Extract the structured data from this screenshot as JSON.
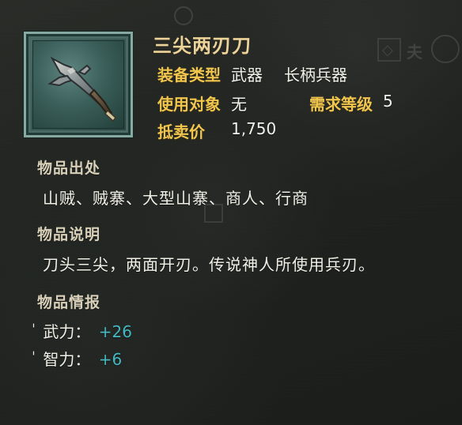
{
  "item": {
    "name": "三尖两刃刀"
  },
  "attributes": {
    "equipment_type_label": "装备类型",
    "equipment_type_value": "武器",
    "equipment_subtype_value": "长柄兵器",
    "use_target_label": "使用对象",
    "use_target_value": "无",
    "required_level_label": "需求等级",
    "required_level_value": "5",
    "sell_price_label": "抵卖价",
    "sell_price_value": "1,750"
  },
  "sections": {
    "source_title": "物品出处",
    "source_text": "山贼、贼寨、大型山寨、商人、行商",
    "description_title": "物品说明",
    "description_text": "刀头三尖，两面开刃。传说神人所使用兵刃。",
    "info_title": "物品情报"
  },
  "stats": [
    {
      "name": "武力：",
      "value": "+26"
    },
    {
      "name": "智力：",
      "value": "+6"
    }
  ],
  "colors": {
    "title": "#ebd39a",
    "label": "#f0c64f",
    "value": "#f2f2ea",
    "section_title": "#d8d0b8",
    "stat_value": "#44b8c0",
    "frame": "#88a9a2"
  },
  "icons": {
    "item_icon": "spear-icon"
  }
}
